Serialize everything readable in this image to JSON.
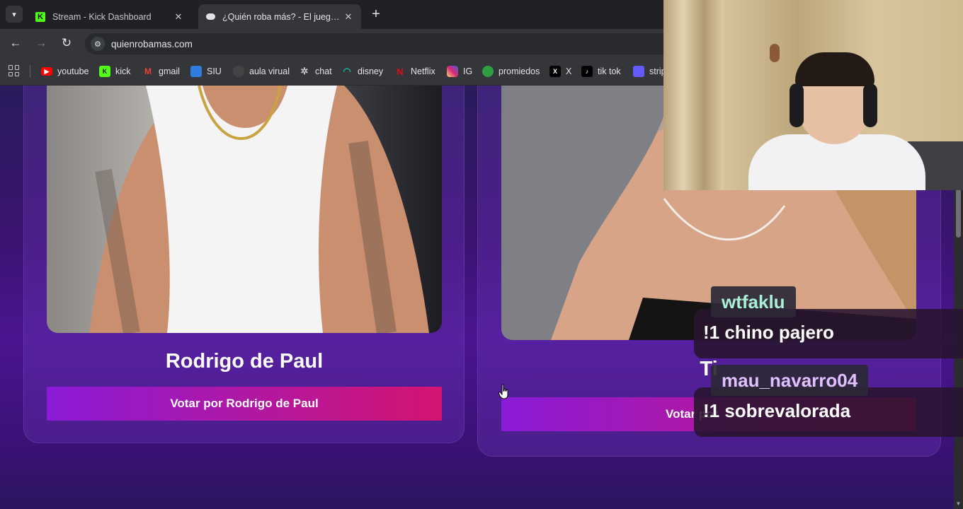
{
  "tabs": [
    {
      "title": "Stream - Kick Dashboard",
      "favicon": "kick-icon",
      "active": false
    },
    {
      "title": "¿Quién roba más? - El juego que",
      "favicon": "game-controller-icon",
      "active": true
    }
  ],
  "toolbar": {
    "url": "quienrobamas.com"
  },
  "bookmarks": [
    {
      "label": "youtube",
      "icon": "youtube-icon",
      "color": "#ff0000"
    },
    {
      "label": "kick",
      "icon": "kick-icon",
      "color": "#53fc18"
    },
    {
      "label": "gmail",
      "icon": "gmail-icon",
      "color": "#ea4335"
    },
    {
      "label": "SIU",
      "icon": "siu-icon",
      "color": "#2f7de1"
    },
    {
      "label": "aula virual",
      "icon": "moodle-icon",
      "color": "#444444"
    },
    {
      "label": "chat",
      "icon": "openai-icon",
      "color": "#c4c7c5"
    },
    {
      "label": "disney",
      "icon": "disney-icon",
      "color": "#1fb6a6"
    },
    {
      "label": "Netflix",
      "icon": "netflix-icon",
      "color": "#e50914"
    },
    {
      "label": "IG",
      "icon": "instagram-icon",
      "color": "#d62976"
    },
    {
      "label": "promiedos",
      "icon": "promiedos-icon",
      "color": "#2ea043"
    },
    {
      "label": "X",
      "icon": "x-icon",
      "color": "#000000"
    },
    {
      "label": "tik tok",
      "icon": "tiktok-icon",
      "color": "#000000"
    },
    {
      "label": "strip",
      "icon": "stripe-icon",
      "color": "#635bff"
    }
  ],
  "main": {
    "candidates": [
      {
        "name": "Rodrigo de Paul",
        "vote_label": "Votar por Rodrigo de Paul"
      },
      {
        "name": "Ti",
        "vote_label": "Votar por"
      }
    ]
  },
  "chat": [
    {
      "user": "wtfaklu",
      "message": "!1 chino pajero",
      "user_color": "#a8f0d8"
    },
    {
      "user": "mau_navarro04",
      "message": "!1 sobrevalorada",
      "user_color": "#e2c0ff"
    }
  ]
}
